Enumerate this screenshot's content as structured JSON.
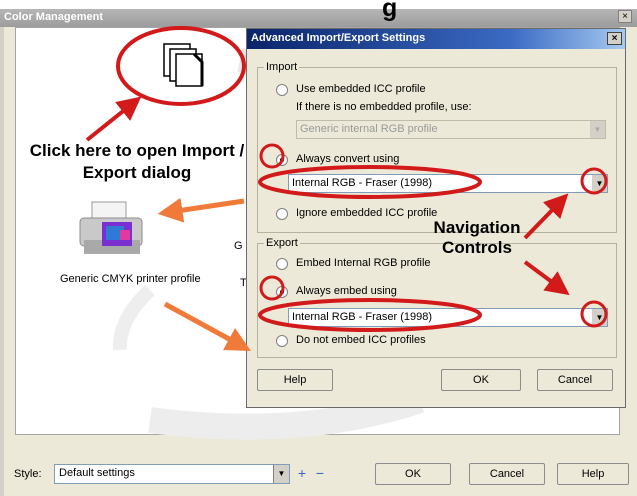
{
  "window": {
    "title": "Color Management",
    "title_fragment": "g",
    "close_glyph": "×"
  },
  "canvas": {
    "printer_label": "Generic CMYK printer profile",
    "fragment_g": "G",
    "fragment_t": "T"
  },
  "annotations": {
    "open_dialog": "Click here to open Import / Export dialog",
    "navigation": "Navigation Controls"
  },
  "toolbar": {
    "style_label": "Style:",
    "style_value": "Default settings",
    "ok": "OK",
    "cancel": "Cancel",
    "help": "Help"
  },
  "dialog": {
    "title": "Advanced Import/Export Settings",
    "close_glyph": "×",
    "import": {
      "label": "Import",
      "opt_embedded": "Use embedded ICC profile",
      "if_none": "If there is no embedded profile, use:",
      "fallback_value": "Generic internal RGB profile",
      "opt_always": "Always convert using",
      "always_value": "Internal RGB - Fraser (1998)",
      "opt_ignore": "Ignore embedded ICC profile"
    },
    "export": {
      "label": "Export",
      "opt_embed_internal": "Embed Internal RGB profile",
      "opt_always": "Always embed using",
      "always_value": "Internal RGB - Fraser (1998)",
      "opt_none": "Do not embed ICC profiles"
    },
    "buttons": {
      "help": "Help",
      "ok": "OK",
      "cancel": "Cancel"
    }
  },
  "colors": {
    "highlight_red": "#d21a1a",
    "arrow_orange": "#f07a3a",
    "dialog_title": "#0a246a"
  }
}
